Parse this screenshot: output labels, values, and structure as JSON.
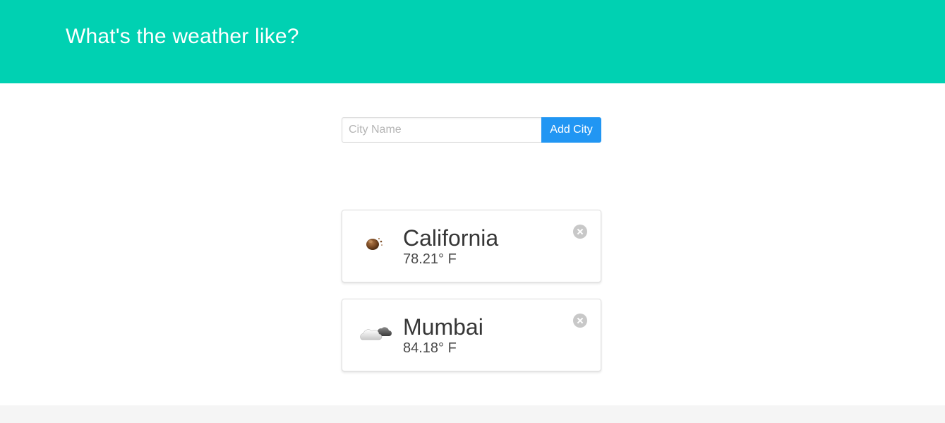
{
  "header": {
    "title": "What's the weather like?",
    "background": "#00d1b2"
  },
  "form": {
    "placeholder": "City Name",
    "value": "",
    "button_label": "Add City",
    "button_color": "#2196f3"
  },
  "cities": [
    {
      "name": "California",
      "temperature": "78.21° F",
      "icon": "haze-icon"
    },
    {
      "name": "Mumbai",
      "temperature": "84.18° F",
      "icon": "partly-cloudy-icon"
    }
  ]
}
